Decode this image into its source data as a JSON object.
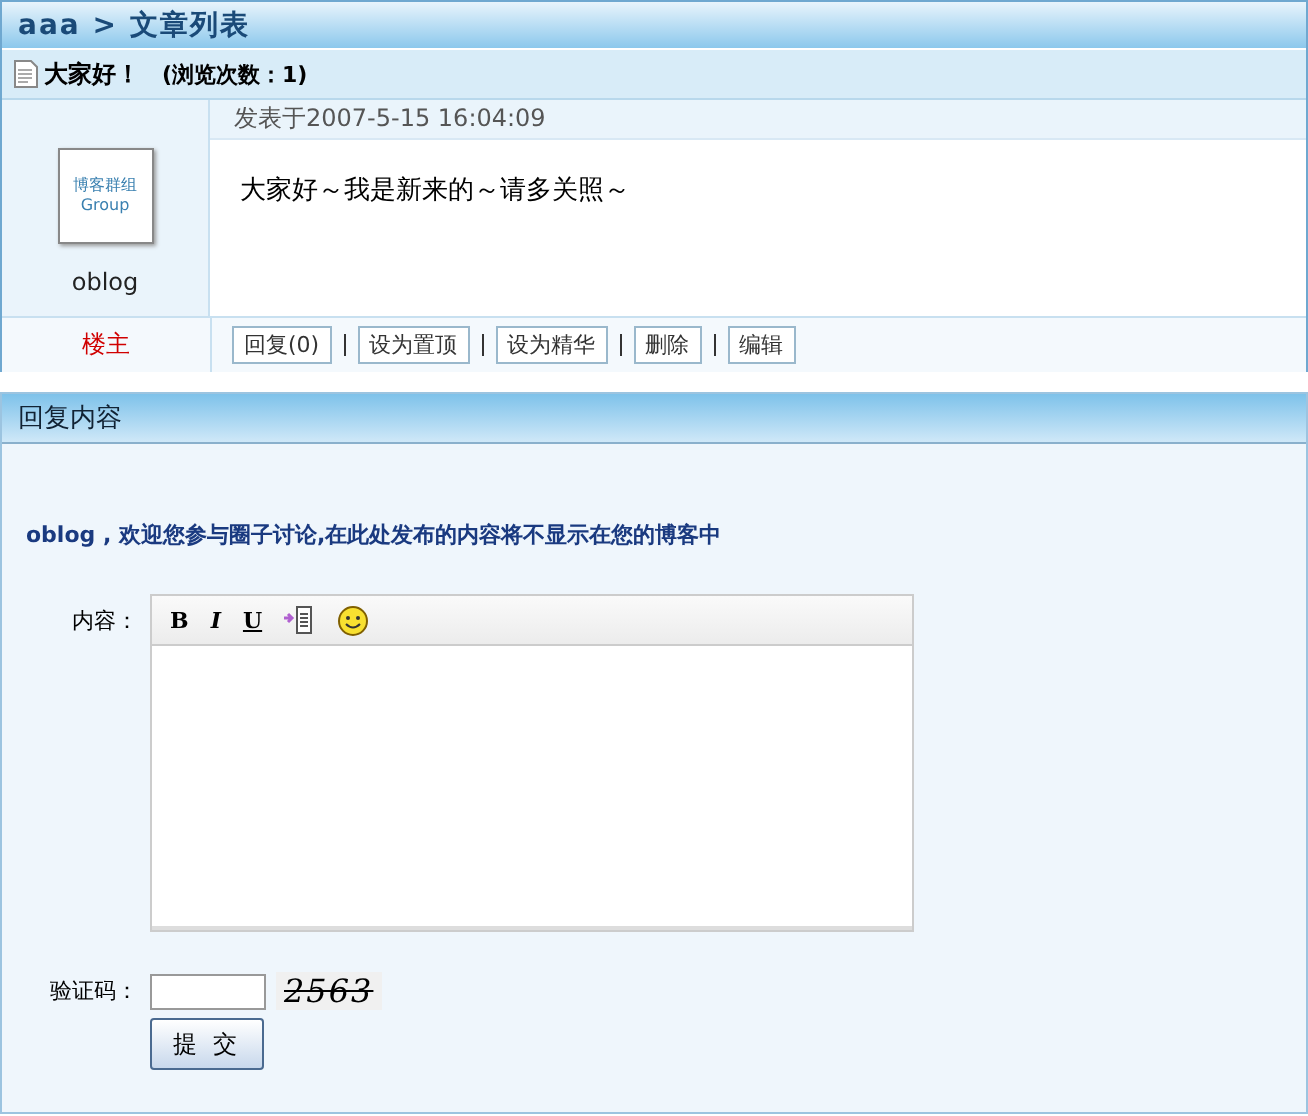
{
  "breadcrumb": {
    "site": "aaa",
    "separator": ">",
    "page": "文章列表"
  },
  "post": {
    "title": "大家好！",
    "views": "(浏览次数：1)",
    "date": "发表于2007-5-15 16:04:09",
    "body": "大家好～我是新来的～请多关照～",
    "author": {
      "name": "oblog",
      "role": "楼主",
      "avatar_lines": [
        "博客群组",
        "Group"
      ]
    },
    "actions": [
      "回复(0)",
      "设为置顶",
      "设为精华",
      "删除",
      "编辑"
    ]
  },
  "reply": {
    "title": "回复内容",
    "notice": "oblog , 欢迎您参与圈子讨论,在此处发布的内容将不显示在您的博客中",
    "content_label": "内容：",
    "toolbar": [
      {
        "kind": "bold",
        "label": "B"
      },
      {
        "kind": "italic",
        "label": "I"
      },
      {
        "kind": "underline",
        "label": "U"
      },
      {
        "kind": "insert"
      },
      {
        "kind": "emoji"
      }
    ],
    "captcha_label": "验证码：",
    "captcha": "2563",
    "submit": "提 交"
  }
}
